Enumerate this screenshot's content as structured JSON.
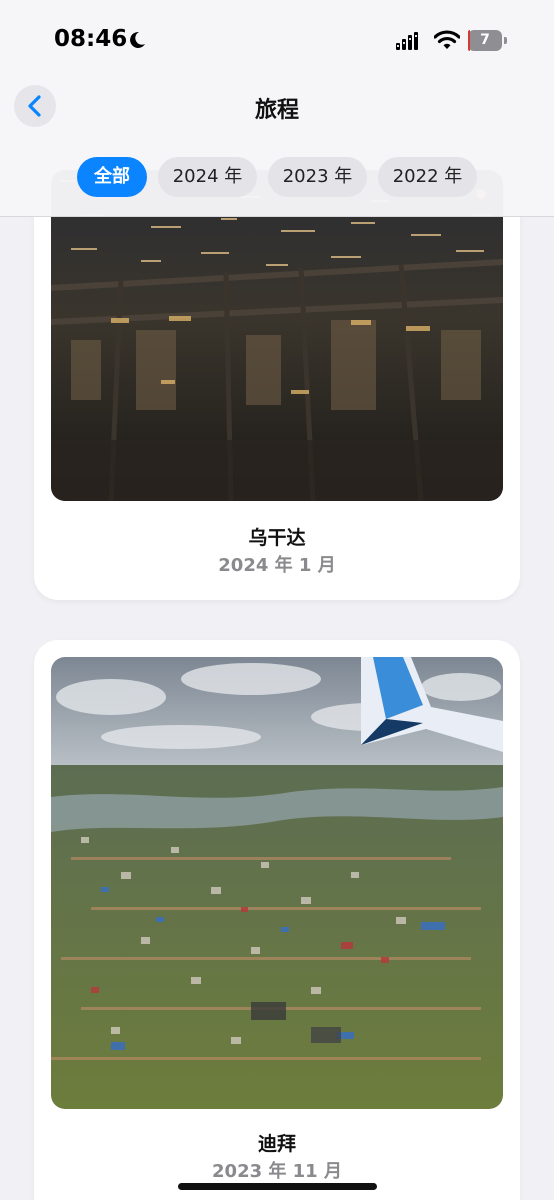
{
  "status_bar": {
    "time": "08:46",
    "battery_level": "7",
    "battery_fraction": 0.07,
    "icons": [
      "moon-icon",
      "signal-icon",
      "wifi-icon",
      "battery-icon"
    ]
  },
  "nav": {
    "title": "旅程",
    "back_icon": "chevron-left-icon"
  },
  "tabs": [
    {
      "label": "全部",
      "active": true
    },
    {
      "label": "2024 年",
      "active": false
    },
    {
      "label": "2023 年",
      "active": false
    },
    {
      "label": "2022 年",
      "active": false
    }
  ],
  "trips": [
    {
      "title": "乌干达",
      "date": "2024 年 1 月",
      "photo": "night city aerial view from airplane window"
    },
    {
      "title": "迪拜",
      "date": "2023 年 11 月",
      "photo": "aerial view of town and airplane wing"
    }
  ],
  "colors": {
    "accent": "#0a84ff",
    "secondary_text": "#8a8a8e",
    "background": "#f1f1f5",
    "battery_low": "#d23a34"
  }
}
